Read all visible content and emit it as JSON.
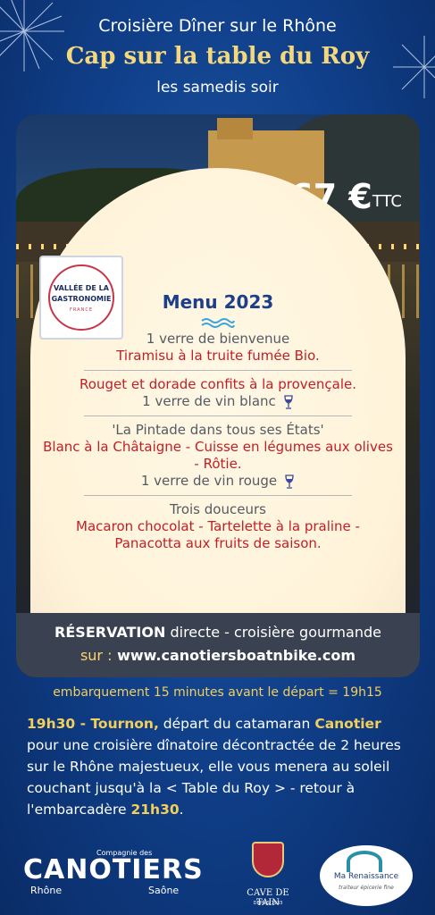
{
  "header": {
    "supertitle": "Croisière Dîner sur le Rhône",
    "title": "Cap sur la table du Roy",
    "subtitle": "les samedis soir"
  },
  "price": {
    "amount": "67 €",
    "suffix": "TTC"
  },
  "badge": {
    "line1": "VALLÉE DE LA",
    "line2": "GASTRONOMIE",
    "line3": "FRANCE"
  },
  "menu": {
    "title": "Menu 2023",
    "course1": [
      "1 verre de bienvenue",
      "Tiramisu à la truite fumée Bio."
    ],
    "course2": [
      "Rouget et dorade confits à la provençale.",
      "1 verre de vin blanc"
    ],
    "course3": [
      "'La Pintade dans tous ses États'",
      "Blanc à la Châtaigne - Cuisse en légumes aux olives",
      "- Rôtie.",
      "1 verre de vin rouge"
    ],
    "course4": [
      "Trois douceurs",
      "Macaron chocolat - Tartelette à la praline -",
      "Panacotta aux fruits de saison."
    ]
  },
  "reservation": {
    "label": "RÉSERVATION",
    "text": "directe - croisière gourmande",
    "sur": "sur :",
    "url": "www.canotiersboatnbike.com"
  },
  "embarkation": "embarquement  15 minutes avant le départ = 19h15",
  "description": {
    "time_start": "19h30 - Tournon,",
    "part1": "départ du catamaran",
    "boat": "Canotier",
    "part2": "pour une croisière dînatoire décontractée de 2 heures sur le Rhône majestueux, elle vous menera au soleil couchant jusqu'à la < Table du Roy > - retour à l'embarcadère",
    "time_end": "21h30",
    "end": "."
  },
  "logos": {
    "canotiers": {
      "top": "Compagnie des",
      "main": "CANOTIERS",
      "left": "Rhône",
      "right": "Saône"
    },
    "cave": {
      "name": "CAVE DE TAIN",
      "since": "DEPUIS 1933"
    },
    "renaissance": {
      "name": "Ma Renaissance",
      "sub": "traiteur épicerie fine"
    }
  },
  "colors": {
    "background": "#0f3d86",
    "title_gold": "#f5d77c",
    "menu_red": "#c21e26",
    "menu_title_blue": "#1d3f8a",
    "reservation_bar": "#3a4150"
  }
}
